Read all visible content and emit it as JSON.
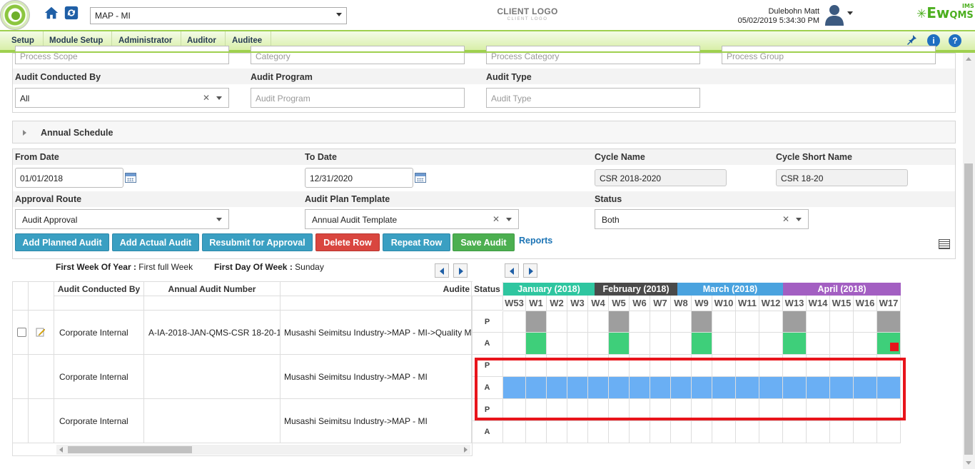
{
  "header": {
    "site_value": "MAP - MI",
    "client_logo": "CLIENT LOGO",
    "client_logo_sub": "CLIENT LOGO",
    "user_name": "Dulebohn Matt",
    "datetime": "05/02/2019 5:34:30 PM",
    "brand": "Ew",
    "brand_suffix": "QMS",
    "brand_ims": "IMS"
  },
  "menu": {
    "items": [
      "Setup",
      "Module Setup",
      "Administrator",
      "Auditor",
      "Auditee"
    ]
  },
  "filters": {
    "top_placeholders": [
      "Process Scope",
      "Category",
      "Process Category",
      "Process Group"
    ],
    "audit_conducted_by_label": "Audit Conducted By",
    "audit_conducted_by_value": "All",
    "audit_program_label": "Audit Program",
    "audit_program_placeholder": "Audit Program",
    "audit_type_label": "Audit Type",
    "audit_type_placeholder": "Audit Type"
  },
  "annual_schedule": {
    "title": "Annual Schedule",
    "from_date_label": "From Date",
    "from_date_value": "01/01/2018",
    "to_date_label": "To Date",
    "to_date_value": "12/31/2020",
    "cycle_name_label": "Cycle Name",
    "cycle_name_value": "CSR 2018-2020",
    "cycle_short_label": "Cycle Short Name",
    "cycle_short_value": "CSR 18-20",
    "approval_route_label": "Approval Route",
    "approval_route_value": "Audit Approval",
    "template_label": "Audit Plan Template",
    "template_value": "Annual Audit Template",
    "status_label": "Status",
    "status_value": "Both"
  },
  "actions": {
    "add_planned": "Add Planned Audit",
    "add_actual": "Add Actual Audit",
    "resubmit": "Resubmit for Approval",
    "delete_row": "Delete Row",
    "repeat_row": "Repeat Row",
    "save_audit": "Save Audit",
    "reports": "Reports"
  },
  "week_info": {
    "first_week_label": "First Week Of Year :",
    "first_week_value": "First full Week",
    "first_day_label": "First Day Of Week :",
    "first_day_value": "Sunday"
  },
  "grid": {
    "columns": [
      "Audit Conducted By",
      "Annual Audit Number",
      "Audite",
      "Status"
    ],
    "rows": [
      {
        "conducted_by": "Corporate Internal",
        "number": "A-IA-2018-JAN-QMS-CSR 18-20-1",
        "auditee": "Musashi Seimitsu Industry->MAP - MI->Quality M"
      },
      {
        "conducted_by": "Corporate Internal",
        "number": "",
        "auditee": "Musashi Seimitsu Industry->MAP - MI"
      },
      {
        "conducted_by": "Corporate Internal",
        "number": "",
        "auditee": "Musashi Seimitsu Industry->MAP - MI"
      }
    ],
    "status_labels": [
      "P",
      "A",
      "P",
      "A",
      "P",
      "A"
    ]
  },
  "schedule": {
    "months": [
      {
        "label": "January (2018)",
        "color": "#2fc6a0"
      },
      {
        "label": "February (2018)",
        "color": "#4a4a4a"
      },
      {
        "label": "March (2018)",
        "color": "#4aa3df"
      },
      {
        "label": "April (2018)",
        "color": "#a35fc2"
      }
    ],
    "weeks": [
      "W53",
      "W1",
      "W2",
      "W3",
      "W4",
      "W5",
      "W6",
      "W7",
      "W8",
      "W9",
      "W10",
      "W11",
      "W12",
      "W13",
      "W14",
      "W15",
      "W16",
      "W17"
    ]
  },
  "colors": {
    "planned": "#9e9e9e",
    "actual": "#3ecf7a",
    "selected_row": "#6aaff4",
    "highlight": "#e8141b",
    "menu_bg": "#d8efa8"
  }
}
